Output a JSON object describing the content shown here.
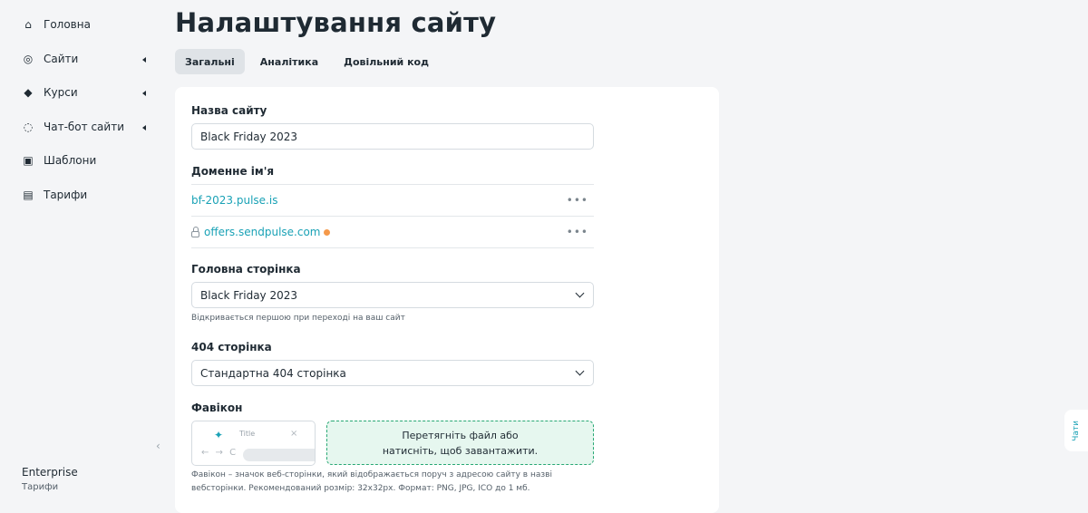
{
  "sidebar": {
    "items": [
      {
        "label": "Головна",
        "icon": "home-icon",
        "glyph": "⌂"
      },
      {
        "label": "Сайти",
        "icon": "sites-icon",
        "glyph": "◎"
      },
      {
        "label": "Курси",
        "icon": "graduation-cap-icon",
        "glyph": "◆"
      },
      {
        "label": "Чат-бот сайти",
        "icon": "chat-icon",
        "glyph": "◌"
      },
      {
        "label": "Шаблони",
        "icon": "template-icon",
        "glyph": "▣"
      },
      {
        "label": "Тарифи",
        "icon": "tariff-icon",
        "glyph": "▤"
      }
    ],
    "collapse_glyph": "‹",
    "plan_name": "Enterprise",
    "plan_link": "Тарифи"
  },
  "header": {
    "title": "Налаштування сайту",
    "tabs": [
      {
        "label": "Загальні",
        "active": true
      },
      {
        "label": "Аналітика",
        "active": false
      },
      {
        "label": "Довільний код",
        "active": false
      }
    ]
  },
  "form": {
    "site_name_label": "Назва сайту",
    "site_name_value": "Black Friday 2023",
    "domain_label": "Доменне ім'я",
    "domains": [
      {
        "name": "bf-2023.pulse.is",
        "more": "•••"
      },
      {
        "name": "offers.sendpulse.com",
        "more": "•••"
      }
    ],
    "home_page_label": "Головна сторінка",
    "home_page_value": "Black Friday 2023",
    "home_page_hint": "Відкривається першою при переході на ваш сайт",
    "page404_label": "404 сторінка",
    "page404_value": "Стандартна 404 сторінка",
    "favicon_label": "Фавікон",
    "favicon_preview_title": "Title",
    "favicon_preview_logo": "✦",
    "favicon_preview_close": "×",
    "favicon_preview_nav": "← → C",
    "dropzone_line1": "Перетягніть файл або",
    "dropzone_line2": "натисніть, щоб завантажити.",
    "favicon_hint_line1": "Фавікон – значок веб-сторінки, який відображається поруч з адресою сайту в назві",
    "favicon_hint_line2": "вебсторінки. Рекомендований розмір: 32x32px. Формат: PNG, JPG, ICO до 1 мб."
  },
  "chats_tab": "Чати",
  "colors": {
    "accent": "#1aa2b6",
    "dropzone_border": "#28a874",
    "dropzone_bg": "#e6f7ef",
    "status_dot": "#f5994a",
    "active_tab_bg": "#dfe3e7"
  }
}
